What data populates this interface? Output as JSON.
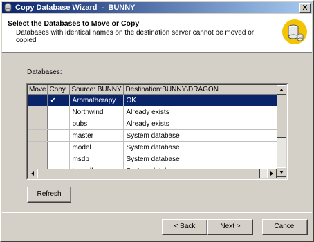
{
  "window": {
    "title": "Copy Database Wizard  -  BUNNY",
    "close_glyph": "X"
  },
  "header": {
    "title": "Select the Databases to Move or Copy",
    "subtitle": "Databases with identical names on the destination server cannot be moved or copied"
  },
  "databases": {
    "label": "Databases:",
    "columns": [
      "Move",
      "Copy",
      "Source: BUNNY",
      "Destination:BUNNY\\DRAGON"
    ],
    "rows": [
      {
        "move": "",
        "copy": "✔",
        "source": "Aromatherapy",
        "destination": "OK",
        "selected": true
      },
      {
        "move": "",
        "copy": "",
        "source": "Northwind",
        "destination": "Already exists"
      },
      {
        "move": "",
        "copy": "",
        "source": "pubs",
        "destination": "Already exists"
      },
      {
        "move": "",
        "copy": "",
        "source": "master",
        "destination": "System database"
      },
      {
        "move": "",
        "copy": "",
        "source": "model",
        "destination": "System database"
      },
      {
        "move": "",
        "copy": "",
        "source": "msdb",
        "destination": "System database"
      },
      {
        "move": "",
        "copy": "",
        "source": "tempdb",
        "destination": "System database"
      }
    ]
  },
  "buttons": {
    "refresh": "Refresh",
    "back": "< Back",
    "next": "Next >",
    "cancel": "Cancel"
  },
  "colors": {
    "title_bar": "#0a246a",
    "selection": "#0a246a",
    "face": "#d4d0c8"
  }
}
